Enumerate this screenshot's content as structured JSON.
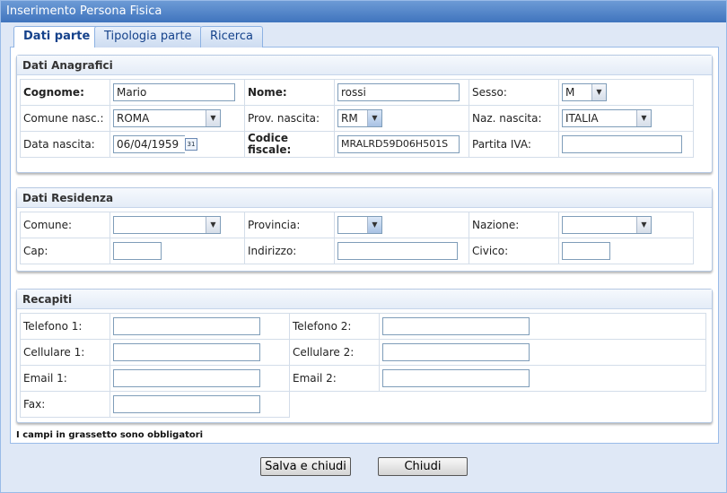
{
  "window": {
    "title": "Inserimento Persona Fisica"
  },
  "tabs": [
    {
      "label": "Dati parte",
      "active": true
    },
    {
      "label": "Tipologia parte",
      "active": false
    },
    {
      "label": "Ricerca",
      "active": false
    }
  ],
  "anagrafici": {
    "title": "Dati Anagrafici",
    "cognome_label": "Cognome:",
    "cognome_value": "Mario",
    "nome_label": "Nome:",
    "nome_value": "rossi",
    "sesso_label": "Sesso:",
    "sesso_value": "M",
    "comune_nasc_label": "Comune nasc.:",
    "comune_nasc_value": "ROMA",
    "prov_nascita_label": "Prov. nascita:",
    "prov_nascita_value": "RM",
    "naz_nascita_label": "Naz. nascita:",
    "naz_nascita_value": "ITALIA",
    "data_nascita_label": "Data nascita:",
    "data_nascita_value": "06/04/1959",
    "calendar_icon_text": "31",
    "codice_fiscale_label_1": "Codice",
    "codice_fiscale_label_2": "fiscale:",
    "codice_fiscale_value": "MRALRD59D06H501S",
    "partita_iva_label": "Partita IVA:",
    "partita_iva_value": ""
  },
  "residenza": {
    "title": "Dati Residenza",
    "comune_label": "Comune:",
    "comune_value": "",
    "provincia_label": "Provincia:",
    "provincia_value": "",
    "nazione_label": "Nazione:",
    "nazione_value": "",
    "cap_label": "Cap:",
    "cap_value": "",
    "indirizzo_label": "Indirizzo:",
    "indirizzo_value": "",
    "civico_label": "Civico:",
    "civico_value": ""
  },
  "recapiti": {
    "title": "Recapiti",
    "telefono1_label": "Telefono 1:",
    "telefono2_label": "Telefono 2:",
    "cellulare1_label": "Cellulare 1:",
    "cellulare2_label": "Cellulare 2:",
    "email1_label": "Email 1:",
    "email2_label": "Email 2:",
    "fax_label": "Fax:"
  },
  "note": "I campi in grassetto sono obbligatori",
  "buttons": {
    "save": "Salva e chiudi",
    "close": "Chiudi"
  },
  "icons": {
    "dropdown": "chevron-down-icon",
    "calendar": "calendar-icon"
  }
}
